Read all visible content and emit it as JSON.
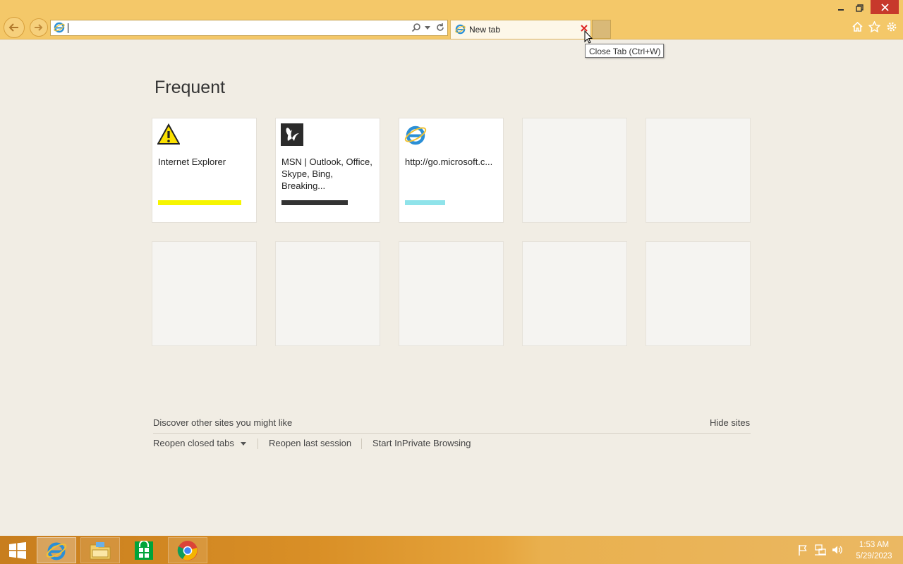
{
  "browser": {
    "address": {
      "value": ""
    },
    "tabs": [
      {
        "title": "New tab",
        "active": true
      }
    ],
    "tooltip": "Close Tab (Ctrl+W)",
    "accent": "#f4c869"
  },
  "new_tab_page": {
    "heading": "Frequent",
    "tiles": [
      {
        "title": "Internet Explorer",
        "icon": "warning-icon",
        "bar_color": "#f6f500",
        "bar_fraction": 0.89
      },
      {
        "title": "MSN | Outlook, Office, Skype, Bing, Breaking...",
        "icon": "msn-butterfly-icon",
        "bar_color": "#333333",
        "bar_fraction": 0.71
      },
      {
        "title": "http://go.microsoft.c...",
        "icon": "ie-icon",
        "bar_color": "#8fe3ea",
        "bar_fraction": 0.43
      }
    ],
    "discover_label": "Discover other sites you might like",
    "hide_sites_label": "Hide sites",
    "reopen_closed_tabs_label": "Reopen closed tabs",
    "reopen_last_session_label": "Reopen last session",
    "inprivate_label": "Start InPrivate Browsing"
  },
  "taskbar": {
    "items": [
      "start-icon",
      "internet-explorer-icon",
      "file-explorer-icon",
      "store-icon",
      "chrome-icon"
    ],
    "time": "1:53 AM",
    "date": "5/29/2023"
  }
}
